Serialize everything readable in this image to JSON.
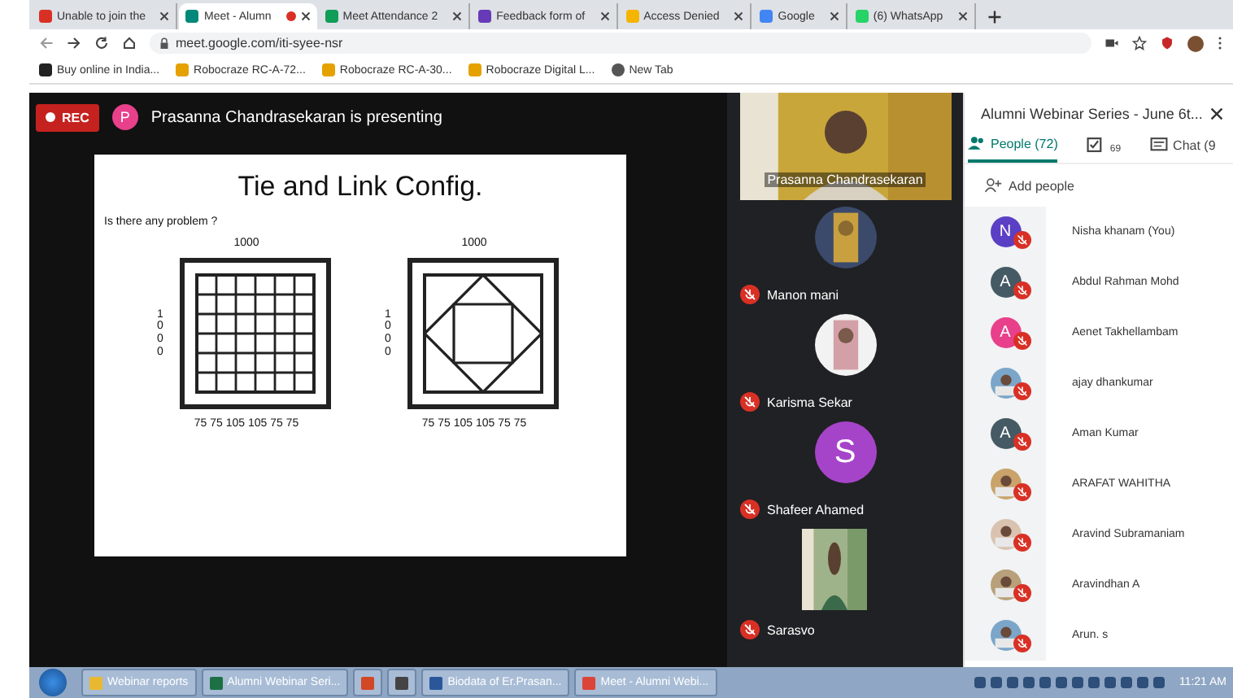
{
  "browser": {
    "tabs": [
      {
        "label": "Unable to join the",
        "selected": false,
        "recording": false
      },
      {
        "label": "Meet - Alumn",
        "selected": true,
        "recording": true
      },
      {
        "label": "Meet Attendance 2",
        "selected": false,
        "recording": false
      },
      {
        "label": "Feedback form of",
        "selected": false,
        "recording": false
      },
      {
        "label": "Access Denied",
        "selected": false,
        "recording": false
      },
      {
        "label": "Google",
        "selected": false,
        "recording": false
      },
      {
        "label": "(6) WhatsApp",
        "selected": false,
        "recording": false
      }
    ],
    "address": "meet.google.com/iti-syee-nsr",
    "bookmarks": [
      {
        "label": "Buy online in India..."
      },
      {
        "label": "Robocraze RC-A-72..."
      },
      {
        "label": "Robocraze RC-A-30..."
      },
      {
        "label": "Robocraze Digital L..."
      },
      {
        "label": "New Tab"
      }
    ]
  },
  "meet": {
    "rec": "REC",
    "presenter_initial": "P",
    "presenting": "Prasanna Chandrasekaran is presenting",
    "slide": {
      "title": "Tie and Link Config.",
      "question": "Is there any problem ?",
      "sections": [
        {
          "span": "1000",
          "depth": "1000",
          "spacing": "75 75 105 105 75 75"
        },
        {
          "span": "1000",
          "depth": "1000",
          "spacing": "75 75 105 105 75 75"
        }
      ]
    },
    "tiles": [
      {
        "name": "Prasanna Chandrasekaran",
        "kind": "video"
      },
      {
        "name": "Manon mani"
      },
      {
        "name": "Karisma Sekar"
      },
      {
        "name": "Shafeer Ahamed",
        "kind": "initial",
        "initial": "S",
        "color": "#a644c9"
      },
      {
        "name": "Sarasvo",
        "kind": "video"
      }
    ]
  },
  "panel": {
    "title": "Alumni Webinar Series - June 6t...",
    "tabs": [
      {
        "label": "People (72)",
        "selected": true
      },
      {
        "label": "69",
        "selected": false
      },
      {
        "label": "Chat (9",
        "selected": false
      }
    ],
    "add": "Add people",
    "people": [
      {
        "name": "Nisha khanam (You)",
        "kind": "initial",
        "initial": "N",
        "color": "#5b3fc4"
      },
      {
        "name": "Abdul Rahman Mohd",
        "kind": "initial",
        "initial": "A",
        "color": "#455a64"
      },
      {
        "name": "Aenet Takhellambam",
        "kind": "initial",
        "initial": "A",
        "color": "#e8408a"
      },
      {
        "name": "ajay dhankumar"
      },
      {
        "name": "Aman Kumar",
        "kind": "initial",
        "initial": "A",
        "color": "#455a64"
      },
      {
        "name": "ARAFAT WAHITHA"
      },
      {
        "name": "Aravind Subramaniam"
      },
      {
        "name": "Aravindhan A"
      },
      {
        "name": "Arun. s"
      }
    ]
  },
  "taskbar": {
    "items": [
      {
        "kind": "window",
        "label": "Webinar reports"
      },
      {
        "kind": "window",
        "label": "Alumni Webinar Seri..."
      },
      {
        "kind": "pinned"
      },
      {
        "kind": "pinned"
      },
      {
        "kind": "window",
        "label": "Biodata of Er.Prasan..."
      },
      {
        "kind": "window",
        "label": "Meet - Alumni Webi..."
      }
    ],
    "clock": "11:21 AM"
  }
}
